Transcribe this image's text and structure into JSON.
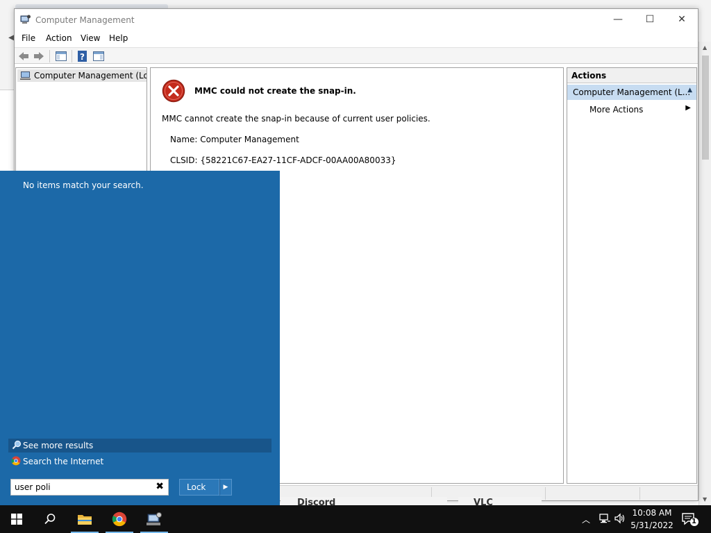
{
  "window": {
    "title": "Computer Management",
    "menu": [
      "File",
      "Action",
      "View",
      "Help"
    ]
  },
  "tree": {
    "root_label": "Computer Management (Local"
  },
  "error": {
    "title": "MMC could not create the snap-in.",
    "message": "MMC cannot create the snap-in because of current user policies.",
    "name_line": "Name: Computer Management",
    "clsid_line": "CLSID: {58221C67-EA27-11CF-ADCF-00AA00A80033}"
  },
  "actions": {
    "header": "Actions",
    "section": "Computer Management (L...",
    "more_actions": "More Actions"
  },
  "background": {
    "discord": "Discord",
    "vlc": "VLC"
  },
  "start": {
    "no_items": "No items match your search.",
    "see_more": "See more results",
    "search_internet": "Search the Internet",
    "search_value": "user poli",
    "lock_label": "Lock"
  },
  "taskbar": {
    "time": "10:08 AM",
    "date": "5/31/2022",
    "notification_count": "1",
    "pinned": [
      "start-icon",
      "search-icon",
      "file-explorer-icon",
      "chrome-icon",
      "computer-management-icon"
    ]
  },
  "colors": {
    "start_panel": "#1c69a8",
    "selected_action": "#c7dcf1",
    "error_red": "#c42b1c",
    "taskbar": "#101010"
  }
}
